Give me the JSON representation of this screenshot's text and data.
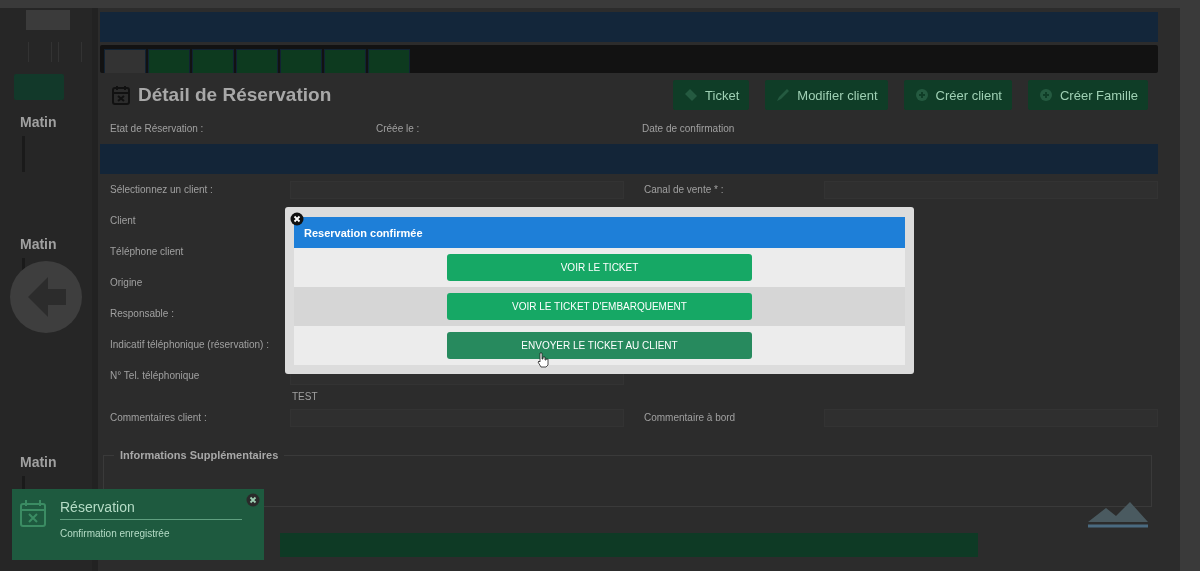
{
  "sidebar": {
    "sections": [
      {
        "title": "Matin"
      },
      {
        "title": "Matin"
      },
      {
        "title": "Matin"
      }
    ]
  },
  "tabs": [
    {
      "selected": true
    },
    {
      "selected": false
    },
    {
      "selected": false
    },
    {
      "selected": false
    },
    {
      "selected": false
    },
    {
      "selected": false
    },
    {
      "selected": false
    }
  ],
  "page": {
    "title": "Détail de Réservation",
    "actions": [
      {
        "label": "Ticket",
        "kind": "ticket"
      },
      {
        "label": "Modifier client",
        "kind": "edit"
      },
      {
        "label": "Créer client",
        "kind": "add"
      },
      {
        "label": "Créer Famille",
        "kind": "add"
      }
    ],
    "info": [
      "Etat de Réservation :",
      "Créée le :",
      "Date de confirmation"
    ]
  },
  "form": {
    "rows": [
      {
        "left": "Sélectionnez un client :",
        "right": "Canal de vente * :"
      },
      {
        "left": "Client"
      },
      {
        "left": "Téléphone client"
      },
      {
        "left": "Origine"
      },
      {
        "left": "Responsable :"
      },
      {
        "left": "Indicatif téléphonique (réservation) :"
      },
      {
        "left": "N° Tel. téléphonique"
      },
      {
        "left": "Commentaires client :",
        "right": "Commentaire à bord",
        "note": "TEST"
      }
    ],
    "extra_title": "Informations Supplémentaires"
  },
  "modal": {
    "title": "Reservation confirmée",
    "buttons": [
      {
        "label": "VOIR LE TICKET",
        "hovered": false
      },
      {
        "label": "VOIR LE TICKET D'EMBARQUEMENT",
        "hovered": false
      },
      {
        "label": "ENVOYER LE TICKET AU CLIENT",
        "hovered": true
      }
    ]
  },
  "toast": {
    "title": "Réservation",
    "message": "Confirmation enregistrée"
  }
}
